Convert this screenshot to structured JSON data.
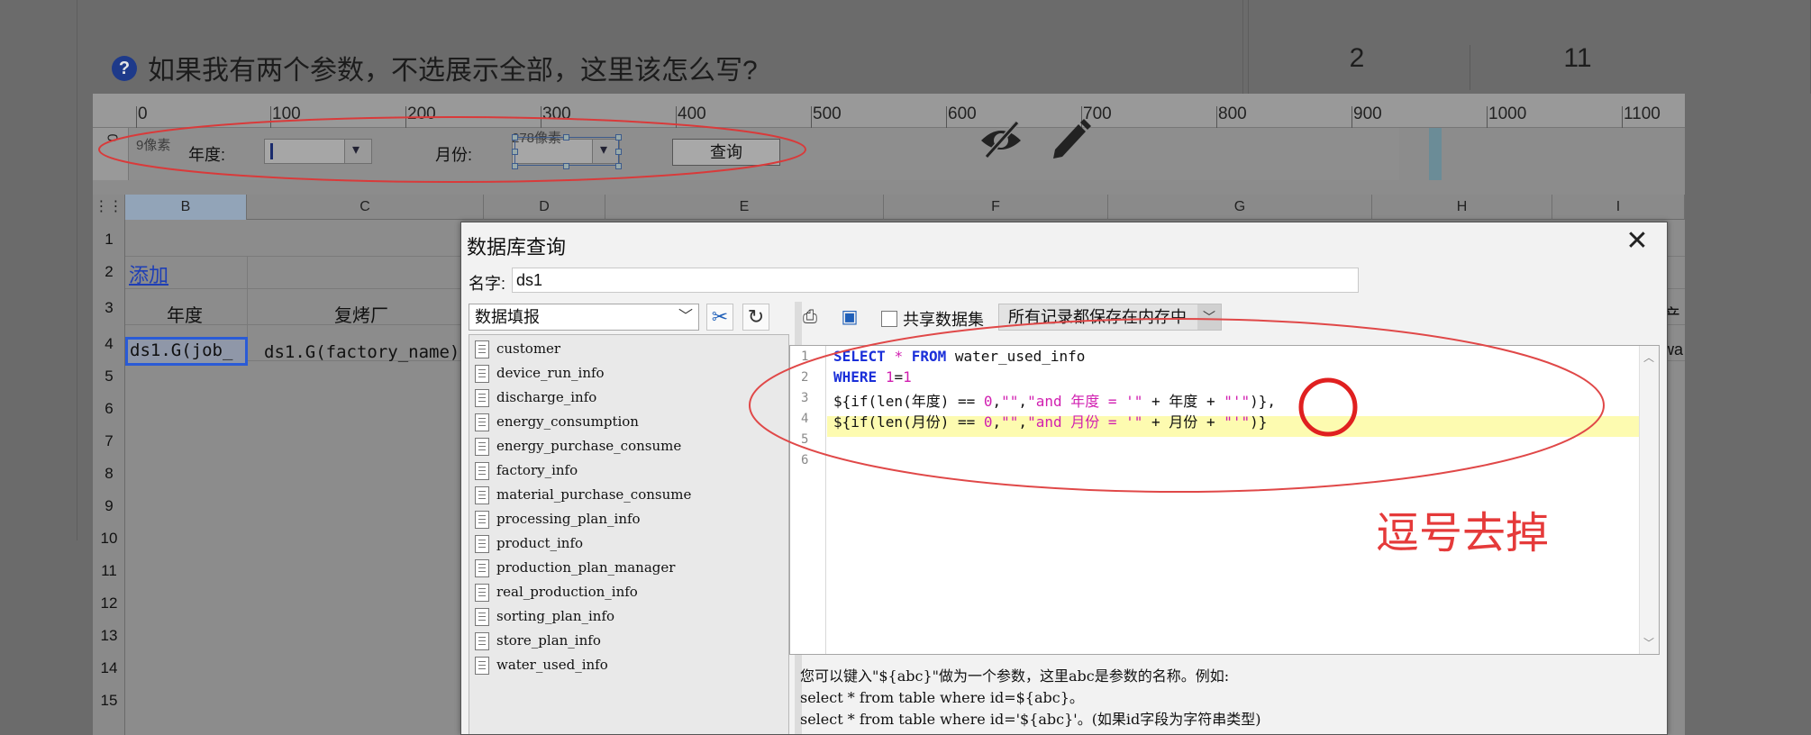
{
  "forum": {
    "question": "如果我有两个参数，不选展示全部，这里该怎么写?",
    "right_columns": [
      "2",
      "11"
    ]
  },
  "ruler": {
    "labels": [
      "0",
      "100",
      "200",
      "300",
      "400",
      "500",
      "600",
      "700",
      "800",
      "900",
      "1000",
      "1100"
    ],
    "left_label": "0"
  },
  "params": {
    "year_label": "年度:",
    "month_label": "月份:",
    "query_button": "查询",
    "px_hint_1": "9像素",
    "px_hint_2": "278像素"
  },
  "sheet": {
    "columns": [
      "B",
      "C",
      "D",
      "E",
      "F",
      "G",
      "H",
      "I"
    ],
    "rows": [
      "1",
      "2",
      "3",
      "4",
      "5",
      "6",
      "7",
      "8",
      "9",
      "10",
      "11",
      "12",
      "13",
      "14",
      "15"
    ],
    "add_link": "添加",
    "header_year": "年度",
    "header_factory": "复烤厂",
    "cell_b4": "ds1.G(job_",
    "cell_c4": "ds1.G(factory_name)",
    "right_edge_1": "产",
    "right_edge_2": "wa"
  },
  "dialog": {
    "title": "数据库查询",
    "name_label": "名字:",
    "name_value": "ds1",
    "datasource": "数据填报",
    "share_label": "共享数据集",
    "memory_option": "所有记录都保存在内存中",
    "tables": [
      "customer",
      "device_run_info",
      "discharge_info",
      "energy_consumption",
      "energy_purchase_consume",
      "factory_info",
      "material_purchase_consume",
      "processing_plan_info",
      "product_info",
      "production_plan_manager",
      "real_production_info",
      "sorting_plan_info",
      "store_plan_info",
      "water_used_info"
    ],
    "line_numbers": [
      "1",
      "2",
      "3",
      "4",
      "5",
      "6"
    ],
    "help_lines": [
      "您可以键入\"${abc}\"做为一个参数，这里abc是参数的名称。例如:",
      "select * from table where id=${abc}。",
      "select * from table where id='${abc}'。(如果id字段为字符串类型)"
    ]
  },
  "annotation": {
    "text": "逗号去掉"
  }
}
